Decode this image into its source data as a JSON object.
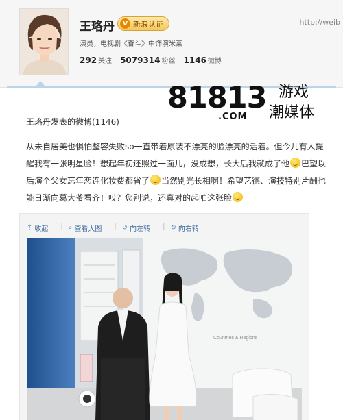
{
  "profile": {
    "name": "王珞丹",
    "verify_label": "新浪认证",
    "url_text": "http://weib",
    "bio": "演员，电视剧《奋斗》中饰演米莱",
    "stats": {
      "following": "292",
      "following_label": "关注",
      "fans": "5079314",
      "fans_label": "粉丝",
      "posts": "1146",
      "posts_label": "微博"
    }
  },
  "watermark": {
    "number": "81813",
    "com": ".COM",
    "line1": "游戏",
    "line2": "潮媒体"
  },
  "feed": {
    "title": "王珞丹发表的微博(1146)"
  },
  "post": {
    "seg1": "从未自居美也惧怕整容失败so一直带着原装不漂亮的脸漂亮的活着。但今儿有人提醒我有一张明星脸！想起年初还照过一面儿，没成想，长大后我就成了他",
    "seg2": "巴望以后演个父女忘年恋连化妆费都省了",
    "seg3": "当然别光长相啊！希望艺德、演技特别片酬也能日渐向葛大爷看齐！哎？您别说，还真对的起咱这张脸"
  },
  "media": {
    "toolbar": {
      "collapse": "收起",
      "view_large": "查看大图",
      "rotate_left": "向左转",
      "rotate_right": "向右转"
    },
    "photo_caption": "Countries & Regions"
  },
  "colors": {
    "link": "#3d6c9e",
    "badge": "#f5c85a",
    "accent_line": "#bcd4ea"
  }
}
